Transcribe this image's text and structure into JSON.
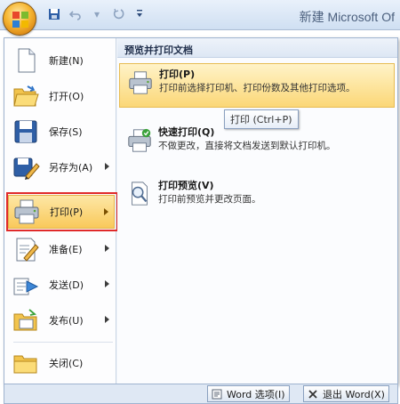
{
  "window": {
    "title": "新建 Microsoft Of"
  },
  "quick_access": [
    {
      "name": "save-icon"
    },
    {
      "name": "undo-icon"
    },
    {
      "name": "redo-icon"
    },
    {
      "name": "customize-dropdown-icon"
    }
  ],
  "left_menu": [
    {
      "label": "新建(N)",
      "icon": "new-document-icon",
      "has_submenu": false
    },
    {
      "label": "打开(O)",
      "icon": "open-folder-icon",
      "has_submenu": false
    },
    {
      "label": "保存(S)",
      "icon": "save-disk-icon",
      "has_submenu": false
    },
    {
      "label": "另存为(A)",
      "icon": "save-as-icon",
      "has_submenu": true
    },
    {
      "label": "打印(P)",
      "icon": "printer-icon",
      "has_submenu": true,
      "selected": true
    },
    {
      "label": "准备(E)",
      "icon": "prepare-icon",
      "has_submenu": true
    },
    {
      "label": "发送(D)",
      "icon": "send-icon",
      "has_submenu": true
    },
    {
      "label": "发布(U)",
      "icon": "publish-icon",
      "has_submenu": true
    },
    {
      "label": "关闭(C)",
      "icon": "close-folder-icon",
      "has_submenu": false
    }
  ],
  "submenu": {
    "header": "预览并打印文档",
    "items": [
      {
        "title": "打印(P)",
        "description": "打印前选择打印机、打印份数及其他打印选项。",
        "icon": "printer-icon",
        "highlighted": true
      },
      {
        "title": "快速打印(Q)",
        "description": "不做更改，直接将文档发送到默认打印机。",
        "icon": "quick-print-icon",
        "highlighted": false
      },
      {
        "title": "打印预览(V)",
        "description": "打印前预览并更改页面。",
        "icon": "print-preview-icon",
        "highlighted": false
      }
    ]
  },
  "tooltip": "打印 (Ctrl+P)",
  "footer": {
    "options_label": "Word 选项(I)",
    "exit_label": "退出 Word(X)"
  },
  "colors": {
    "highlight": "#f9c95a",
    "annotation_frame": "#e02a2a"
  }
}
